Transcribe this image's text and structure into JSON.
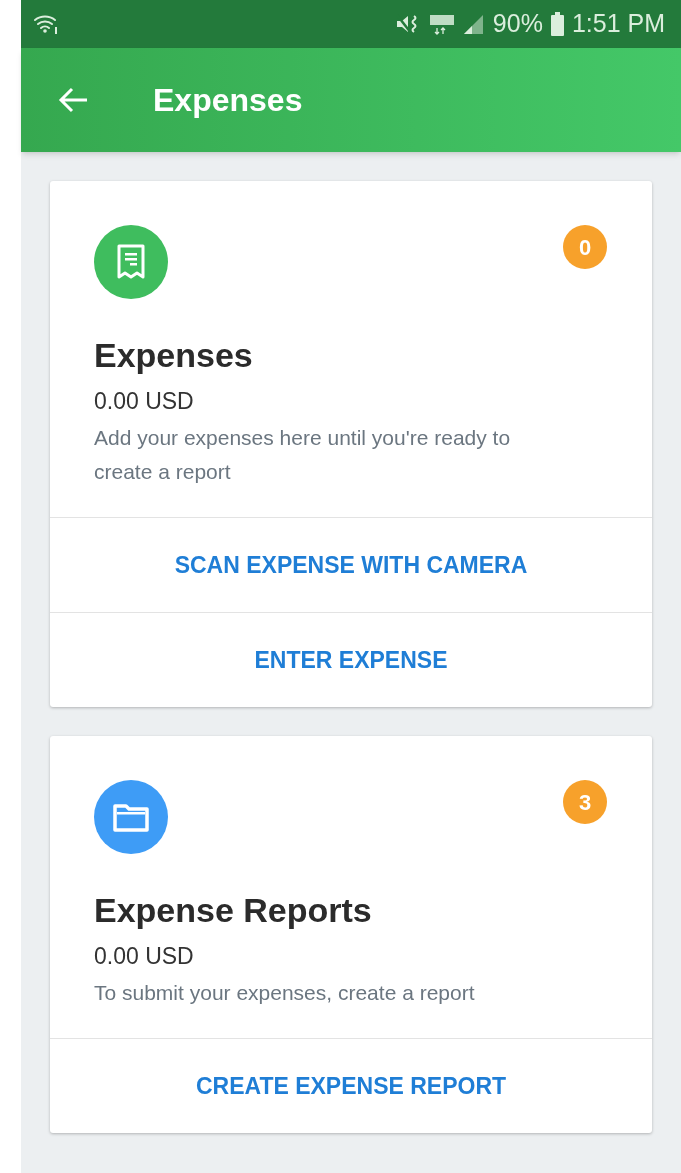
{
  "status_bar": {
    "battery": "90%",
    "time": "1:51 PM"
  },
  "app_bar": {
    "title": "Expenses"
  },
  "cards": [
    {
      "kind": "receipt",
      "color": "#3fbd5e",
      "badge": "0",
      "title": "Expenses",
      "amount": "0.00 USD",
      "description": "Add your expenses here until you're ready to create a report",
      "actions": [
        "SCAN EXPENSE WITH CAMERA",
        "ENTER EXPENSE"
      ]
    },
    {
      "kind": "folder",
      "color": "#3e9cf6",
      "badge": "3",
      "title": "Expense Reports",
      "amount": "0.00 USD",
      "description": "To submit your expenses, create a report",
      "actions": [
        "CREATE EXPENSE REPORT"
      ]
    }
  ]
}
